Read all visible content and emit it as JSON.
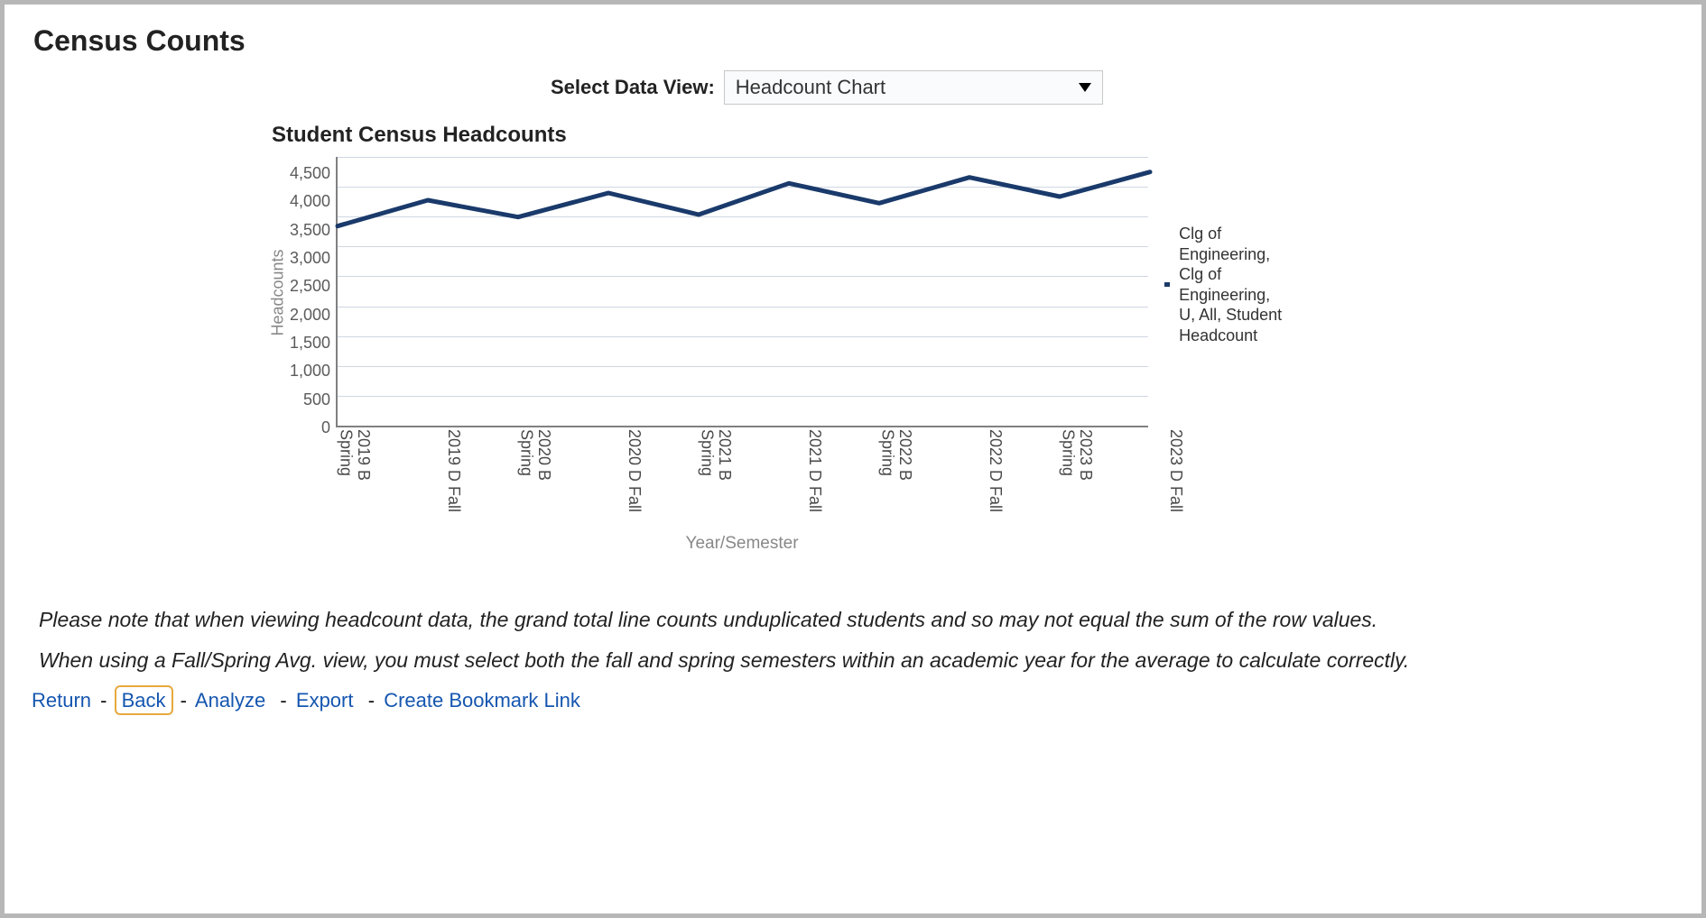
{
  "page_title": "Census Counts",
  "select": {
    "label": "Select Data View:",
    "value": "Headcount Chart"
  },
  "chart_title": "Student Census Headcounts",
  "axes": {
    "y_title": "Headcounts",
    "x_title": "Year/Semester",
    "y_ticks": [
      "4,500",
      "4,000",
      "3,500",
      "3,000",
      "2,500",
      "2,000",
      "1,500",
      "1,000",
      "500",
      "0"
    ]
  },
  "legend": {
    "label": "Clg of Engineering, Clg of Engineering, U, All, Student Headcount",
    "color": "#1a3a6b"
  },
  "chart_data": {
    "type": "line",
    "categories": [
      "2019 B Spring",
      "2019 D Fall",
      "2020 B Spring",
      "2020 D Fall",
      "2021 B Spring",
      "2021 D Fall",
      "2022 B Spring",
      "2022 D Fall",
      "2023 B Spring",
      "2023 D Fall"
    ],
    "series": [
      {
        "name": "Clg of Engineering, Clg of Engineering, U, All, Student Headcount",
        "values": [
          3350,
          3780,
          3500,
          3900,
          3540,
          4060,
          3730,
          4160,
          3840,
          4250
        ]
      }
    ],
    "title": "Student Census Headcounts",
    "xlabel": "Year/Semester",
    "ylabel": "Headcounts",
    "ylim": [
      0,
      4500
    ]
  },
  "notes": {
    "n1": "Please note that when viewing headcount data, the grand total line counts unduplicated students and so may not equal the sum of the row values.",
    "n2": "When using a Fall/Spring Avg. view, you must select both the fall and spring semesters within an academic year for the average to calculate correctly."
  },
  "actions": {
    "return": "Return",
    "back": "Back",
    "analyze": "Analyze",
    "export": "Export",
    "bookmark": "Create Bookmark Link"
  }
}
